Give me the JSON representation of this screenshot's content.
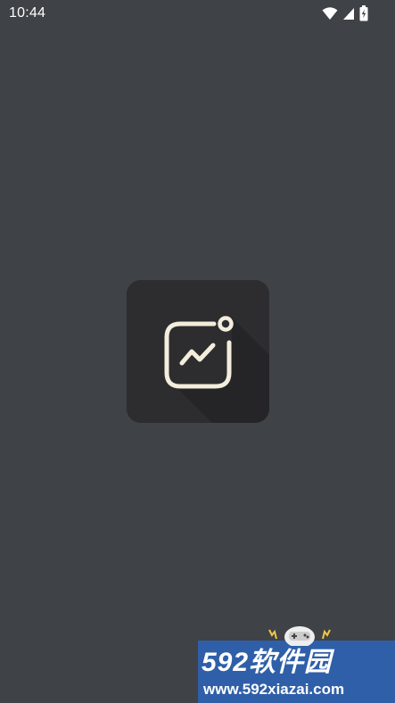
{
  "status_bar": {
    "time": "10:44",
    "icons": [
      "wifi-icon",
      "cell-signal-icon",
      "battery-charging-icon"
    ]
  },
  "splash": {
    "app_icon": "chart-image-icon",
    "icon_bg": "#2d2d2f",
    "icon_stroke": "#f3eddc"
  },
  "watermark": {
    "brand": "592软件园",
    "url": "www.592xiazai.com",
    "bg": "#2f5fa8"
  },
  "colors": {
    "background": "#3f4246"
  }
}
